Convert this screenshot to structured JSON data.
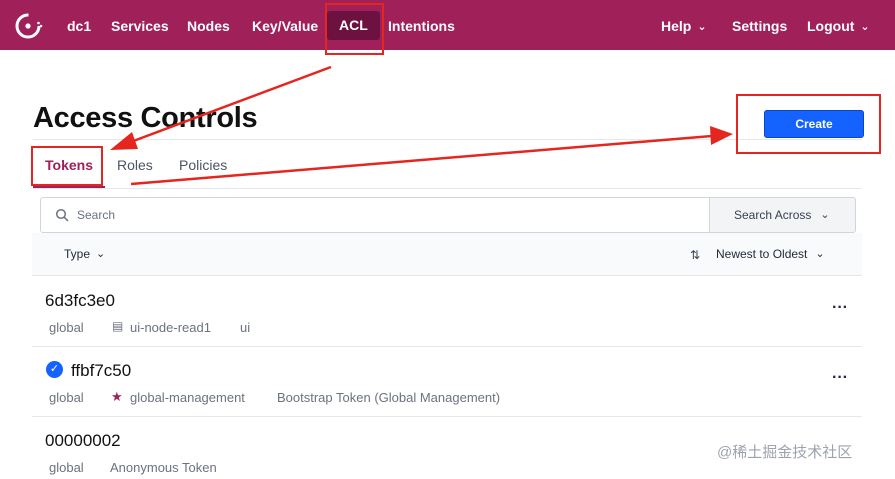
{
  "nav": {
    "datacenter": "dc1",
    "items": [
      "Services",
      "Nodes",
      "Key/Value",
      "ACL",
      "Intentions"
    ],
    "right": {
      "help": "Help",
      "settings": "Settings",
      "logout": "Logout"
    },
    "brand_color": "#a0205a",
    "active_color": "#6d1240"
  },
  "page": {
    "title": "Access Controls",
    "create_label": "Create",
    "tabs": [
      "Tokens",
      "Roles",
      "Policies"
    ],
    "active_tab": "Tokens"
  },
  "search": {
    "placeholder": "Search",
    "across_label": "Search Across"
  },
  "filters": {
    "type_label": "Type",
    "sort_label": "Newest to Oldest"
  },
  "tokens": [
    {
      "id": "6d3fc3e0",
      "scope": "global",
      "link": "ui-node-read1",
      "extra": "ui",
      "icon": "document-icon",
      "current": false
    },
    {
      "id": "ffbf7c50",
      "scope": "global",
      "link": "global-management",
      "extra": "Bootstrap Token (Global Management)",
      "icon": "star-icon",
      "current": true
    },
    {
      "id": "00000002",
      "scope": "global",
      "link": "",
      "extra": "Anonymous Token",
      "icon": "",
      "current": false
    }
  ],
  "row_menu_label": "···",
  "watermark": "@稀土掘金技术社区",
  "annotation_color": "#e5261f",
  "accent": "#1563ff"
}
